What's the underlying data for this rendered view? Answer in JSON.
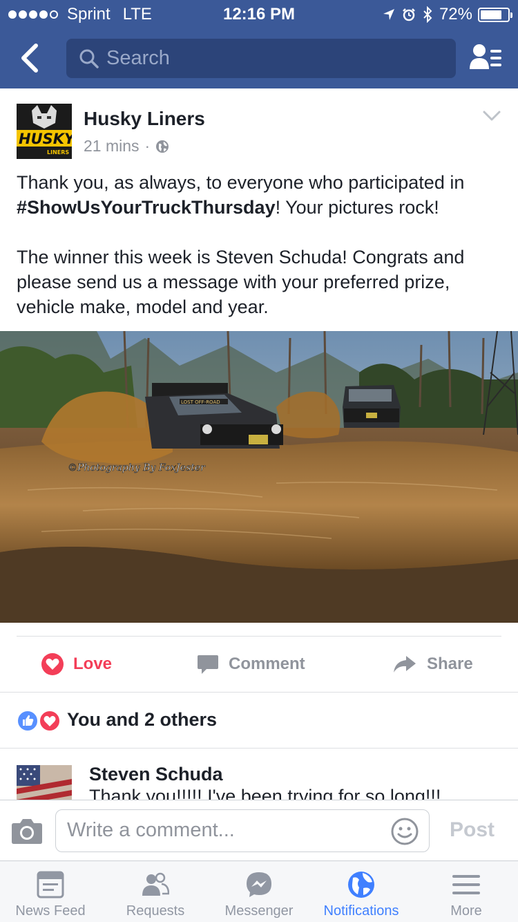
{
  "status_bar": {
    "carrier": "Sprint",
    "network": "LTE",
    "time": "12:16 PM",
    "battery": "72%",
    "battery_level": 0.72,
    "signal_bars_filled": 4,
    "signal_bars_total": 5
  },
  "nav": {
    "search_placeholder": "Search",
    "color": "#3b5998"
  },
  "post": {
    "author": "Husky Liners",
    "avatar_brand": "HUSKY",
    "avatar_brand_sub": "LINERS",
    "time": "21 mins",
    "separator": "·",
    "text_1_before": "Thank you, as always, to everyone who participated in ",
    "hashtag": "#ShowUsYourTruckThursday",
    "text_1_after": "! Your pictures rock!",
    "text_2": "The winner this week is Steven Schuda! Congrats and please send us a message with your preferred prize, vehicle make, model and year.",
    "photo_watermark": "©Photography By FoxJester",
    "photo_plate_text": "LOST OFF-ROAD"
  },
  "actions": {
    "love": "Love",
    "comment": "Comment",
    "share": "Share",
    "love_color": "#f33e58"
  },
  "reactions": {
    "text": "You and 2 others"
  },
  "comment": {
    "author": "Steven Schuda",
    "text": "Thank you!!!!! I've been trying for so long!!!"
  },
  "composer": {
    "placeholder": "Write a comment...",
    "post_label": "Post"
  },
  "tabs": [
    {
      "label": "News Feed",
      "icon": "news-feed-icon",
      "active": false
    },
    {
      "label": "Requests",
      "icon": "friend-requests-icon",
      "active": false
    },
    {
      "label": "Messenger",
      "icon": "messenger-icon",
      "active": false
    },
    {
      "label": "Notifications",
      "icon": "globe-icon",
      "active": true
    },
    {
      "label": "More",
      "icon": "menu-icon",
      "active": false
    }
  ],
  "colors": {
    "brand": "#3b5998",
    "active_tab": "#4080ff",
    "muted": "#90949c"
  }
}
